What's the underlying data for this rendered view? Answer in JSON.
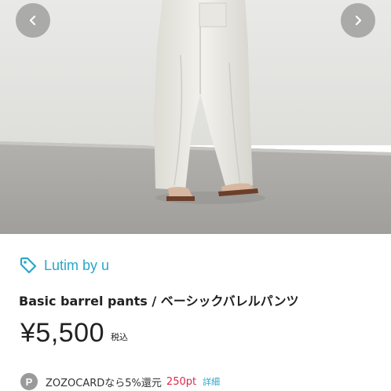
{
  "image": {
    "alt": "Basic barrel pants / ベーシックバレルパンツ",
    "prev_icon": "chevron-left-icon",
    "next_icon": "chevron-right-icon"
  },
  "brand": {
    "icon": "tag-icon",
    "name": "Lutim by u",
    "color": "#2aa7c9"
  },
  "product": {
    "title": "Basic barrel pants / ベーシックバレルパンツ",
    "price": "¥5,500",
    "tax_label": "税込"
  },
  "points": {
    "badge": "P",
    "text": "ZOZOCARDなら5%還元",
    "amount": "250pt",
    "detail_link": "詳細",
    "amount_color": "#e0284b"
  }
}
